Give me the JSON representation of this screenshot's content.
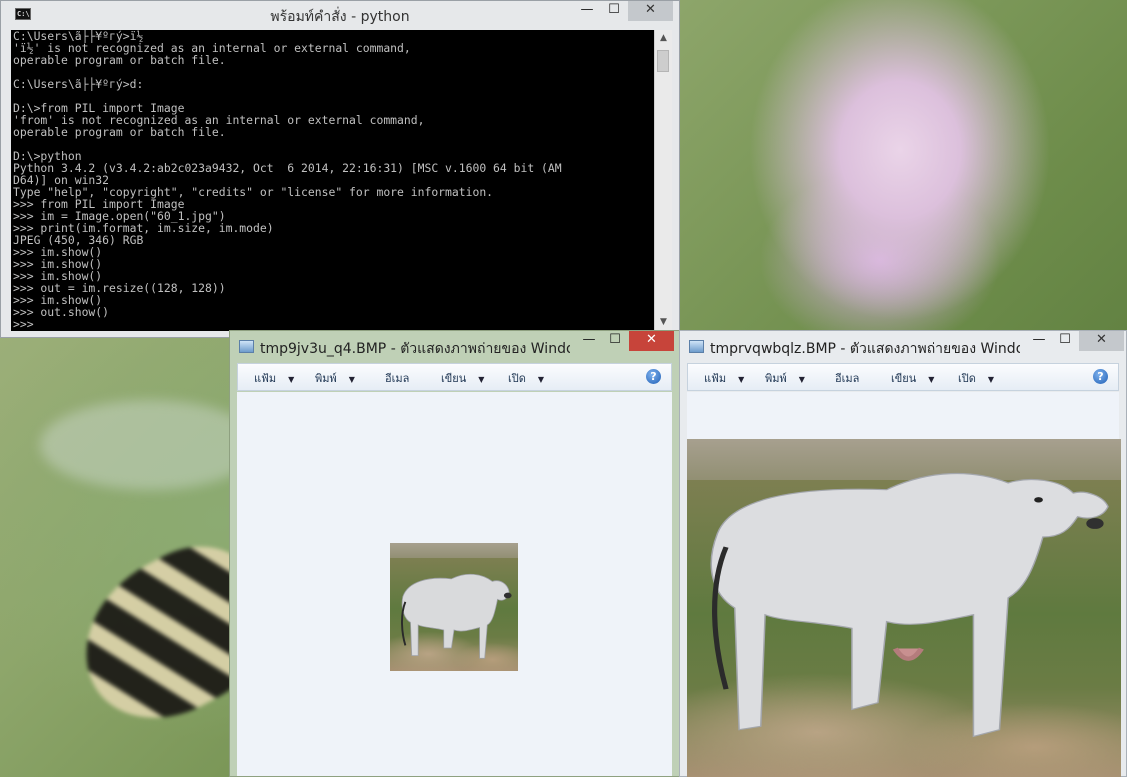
{
  "console": {
    "title": "พร้อมท์คำสั่ง - python",
    "icon": "console-icon",
    "lines": [
      "C:\\Users\\ã├├¥ºгý>ï½",
      "'ï½' is not recognized as an internal or external command,",
      "operable program or batch file.",
      "",
      "C:\\Users\\ã├├¥ºгý>d:",
      "",
      "D:\\>from PIL import Image",
      "'from' is not recognized as an internal or external command,",
      "operable program or batch file.",
      "",
      "D:\\>python",
      "Python 3.4.2 (v3.4.2:ab2c023a9432, Oct  6 2014, 22:16:31) [MSC v.1600 64 bit (AM",
      "D64)] on win32",
      "Type \"help\", \"copyright\", \"credits\" or \"license\" for more information.",
      ">>> from PIL import Image",
      ">>> im = Image.open(\"60_1.jpg\")",
      ">>> print(im.format, im.size, im.mode)",
      "JPEG (450, 346) RGB",
      ">>> im.show()",
      ">>> im.show()",
      ">>> im.show()",
      ">>> out = im.resize((128, 128))",
      ">>> im.show()",
      ">>> out.show()",
      ">>> "
    ],
    "buttons": {
      "minimize": "—",
      "maximize": "☐",
      "close": "✕"
    }
  },
  "viewers": [
    {
      "title": "tmp9jv3u_q4.BMP - ตัวแสดงภาพถ่ายของ Windo...",
      "menu": {
        "file": "แฟ้ม",
        "print": "พิมพ์",
        "email": "อีเมล",
        "burn": "เขียน",
        "open": "เปิด"
      },
      "help": "?",
      "buttons": {
        "minimize": "—",
        "maximize": "☐",
        "close": "✕"
      }
    },
    {
      "title": "tmprvqwbqlz.BMP - ตัวแสดงภาพถ่ายของ Windo...",
      "menu": {
        "file": "แฟ้ม",
        "print": "พิมพ์",
        "email": "อีเมล",
        "burn": "เขียน",
        "open": "เปิด"
      },
      "help": "?",
      "buttons": {
        "minimize": "—",
        "maximize": "☐",
        "close": "✕"
      }
    }
  ],
  "colors": {
    "console_bg": "#000000",
    "console_text": "#c0c0c0",
    "close_active": "#c7443a",
    "viewer_content_bg": "#eff3f9"
  }
}
